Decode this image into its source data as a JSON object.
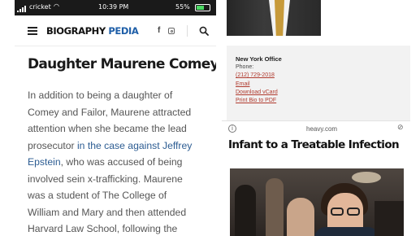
{
  "left_screen": {
    "status_bar": {
      "carrier": "cricket",
      "time": "10:39 PM",
      "battery": "55%"
    },
    "header": {
      "brand_part1": "BIOGRAPHY ",
      "brand_part2": "PEDIA",
      "facebook_glyph": "f",
      "icons": [
        "menu-icon",
        "facebook-icon",
        "instagram-icon",
        "search-icon"
      ]
    },
    "article": {
      "heading": "Daughter Maurene Comey",
      "body_lines": [
        "In addition to being a daughter of",
        "Comey and Failor, Maurene attracted",
        "attention when she became the lead"
      ],
      "line4_prefix": "prosecutor ",
      "line4_link": "in the case against Jeffrey",
      "line5_link": "Epstein",
      "line5_suffix": ", who was accused of being",
      "tail_lines": [
        "involved sein x-trafficking. Maurene",
        "was a student of The College of",
        "William and Mary and then attended",
        "Harvard Law School, following the"
      ]
    }
  },
  "right_screen": {
    "office": {
      "title": "New York Office",
      "phone_label": "Phone:",
      "phone": "(212) 729-2018",
      "links": [
        "Email",
        "Download vCard",
        "Print Bio to PDF"
      ]
    },
    "url_bar": {
      "info_glyph": "i",
      "host": "heavy.com",
      "link_glyph": "⊘"
    },
    "headline": "Infant to a Treatable Infection"
  },
  "colors": {
    "brand_accent": "#1f5fa8",
    "link_blue": "#2c5c92",
    "link_red": "#b03a2e",
    "text_gray": "#555555",
    "status_bar": "#1a1a1a"
  }
}
